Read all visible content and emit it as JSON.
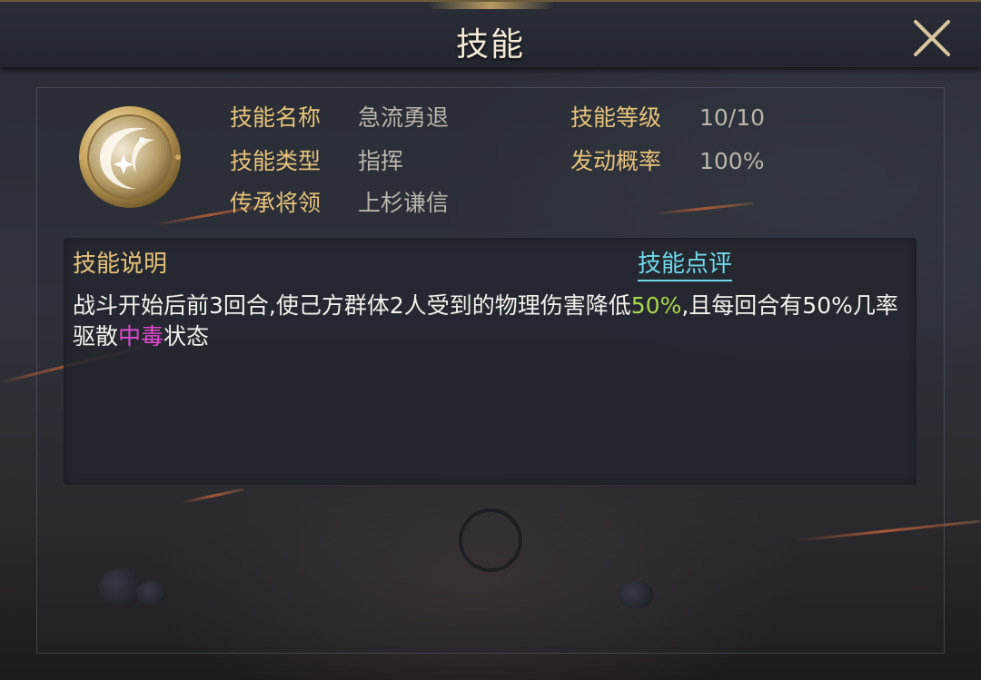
{
  "header": {
    "title": "技能"
  },
  "skill": {
    "icon": "crescent-sparkle-icon",
    "fields": {
      "name_label": "技能名称",
      "name_value": "急流勇退",
      "type_label": "技能类型",
      "type_value": "指挥",
      "inherit_label": "传承将领",
      "inherit_value": "上杉谦信",
      "level_label": "技能等级",
      "level_value": "10/10",
      "rate_label": "发动概率",
      "rate_value": "100%"
    }
  },
  "description": {
    "heading": "技能说明",
    "review_link": "技能点评",
    "text_part1": "战斗开始后前3回合,使己方群体2人受到的物理伤害降低",
    "text_highlight1": "50%",
    "text_part2": ",且每回合有50%几率驱散",
    "text_highlight2": "中毒",
    "text_part3": "状态"
  },
  "colors": {
    "label_gold": "#e6c37b",
    "value_gray": "#b9b4ac",
    "link_cyan": "#6fd8e8",
    "highlight_green": "#a8d84c",
    "highlight_pink": "#e24ad0"
  }
}
